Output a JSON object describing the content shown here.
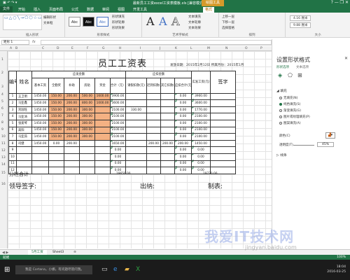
{
  "window": {
    "title": "最新员工工资excel工资表模板.xls [兼容模式] - Excel",
    "context_tab": "绘图工具",
    "window_controls": "?  —  ❐  ✕"
  },
  "ribbon_tabs": [
    "文件",
    "开始",
    "插入",
    "页面布局",
    "公式",
    "数据",
    "审阅",
    "视图",
    "开发工具",
    "格式"
  ],
  "ribbon": {
    "edit_shape": "编辑形状",
    "text_box": "文本框",
    "group_insert_shapes": "插入形状",
    "style_labels": [
      "Abc",
      "Abc",
      "Abc"
    ],
    "shape_fill": "形状填充",
    "shape_outline": "形状轮廓",
    "shape_effects": "形状效果",
    "group_shape_styles": "形状样式",
    "wordart_letters": [
      "A",
      "A",
      "A"
    ],
    "text_fill": "文本填充",
    "text_outline": "文本轮廓",
    "text_effects": "文本效果",
    "group_wordart": "艺术字样式",
    "arrange_items": [
      "上移一层",
      "下移一层",
      "选择窗格"
    ],
    "group_arrange": "排列",
    "height_value": "4.16 厘米",
    "width_value": "9.88 厘米",
    "group_size": "大小"
  },
  "formula_bar": {
    "name_box": "矩形 1",
    "fx_label": "fx",
    "formula": ""
  },
  "columns": [
    "A",
    "B",
    "C",
    "D",
    "E",
    "F",
    "G",
    "H",
    "I",
    "J",
    "K",
    "L",
    "M",
    "N",
    "O",
    "P"
  ],
  "rows": [
    "1",
    "2",
    "3",
    "4",
    "5",
    "6",
    "7",
    "8",
    "9",
    "10",
    "11",
    "12",
    "13",
    "14",
    "15",
    "16"
  ],
  "sheet": {
    "title": "员工工资表",
    "issue_info": "发放日期：2015年2月12日  所属月份：2015年1月",
    "headers": {
      "seq": "编号",
      "name": "姓名",
      "payable_group": "应发金额",
      "base_salary": "基本工资",
      "full_attendance": "全勤奖",
      "subsidy": "补助",
      "overtime": "房贴",
      "bonus": "奖金",
      "total": "合计（元）",
      "deduct_group": "应扣金额",
      "leave_deduct": "请假扣款(元)",
      "other_deduct": "迟到扣款(元)",
      "other_deduct2": "其它扣款(元)",
      "deduct_total": "应扣合计(元)",
      "net_pay": "实发工资(元)",
      "signature": "签字"
    },
    "rows": [
      {
        "no": "1",
        "name": "王卫明",
        "base": "1450.00",
        "full": "150.00",
        "sub": "200.00",
        "ot": "500.00",
        "bonus": "1600.00",
        "total": "3900.00",
        "leave": "",
        "late": "",
        "other": "",
        "dt": "0.00",
        "net": "3900.00"
      },
      {
        "no": "2",
        "name": "马亚鑫",
        "base": "1450.00",
        "full": "150.00",
        "sub": "200.00",
        "ot": "800.00",
        "bonus": "1000.00",
        "total": "3600.00",
        "leave": "",
        "late": "",
        "other": "",
        "dt": "0.00",
        "net": "3600.00"
      },
      {
        "no": "3",
        "name": "刘国旺",
        "base": "1450.00",
        "full": "150.00",
        "sub": "200.00",
        "ot": "300.00",
        "bonus": "",
        "total": "2100.00",
        "leave": "330.00",
        "late": "",
        "other": "",
        "dt": "0.00",
        "net": "1770.00"
      },
      {
        "no": "4",
        "name": "马亚涛",
        "base": "1450.00",
        "full": "150.00",
        "sub": "200.00",
        "ot": "300.00",
        "bonus": "",
        "total": "2100.00",
        "leave": "",
        "late": "",
        "other": "",
        "dt": "0.00",
        "net": "2100.00"
      },
      {
        "no": "5",
        "name": "张爱琴",
        "base": "1450.00",
        "full": "150.00",
        "sub": "200.00",
        "ot": "300.00",
        "bonus": "",
        "total": "2100.00",
        "leave": "",
        "late": "",
        "other": "",
        "dt": "0.00",
        "net": "2100.00"
      },
      {
        "no": "6",
        "name": "高阳",
        "base": "1450.00",
        "full": "150.00",
        "sub": "200.00",
        "ot": "300.00",
        "bonus": "",
        "total": "2100.00",
        "leave": "",
        "late": "",
        "other": "",
        "dt": "0.00",
        "net": "2100.00"
      },
      {
        "no": "7",
        "name": "马亚茹",
        "base": "1450.00",
        "full": "150.00",
        "sub": "200.00",
        "ot": "300.00",
        "bonus": "",
        "total": "2100.00",
        "leave": "",
        "late": "",
        "other": "",
        "dt": "0.00",
        "net": "2100.00"
      },
      {
        "no": "8",
        "name": "司健",
        "base": "1450.00",
        "full": "0.00",
        "sub": "200.00",
        "ot": "",
        "bonus": "",
        "total": "1650.00",
        "leave": "",
        "late": "200.00",
        "other": "200.00",
        "dt": "200.00",
        "net": "1450.00"
      },
      {
        "no": "9",
        "name": "",
        "base": "",
        "full": "",
        "sub": "",
        "ot": "",
        "bonus": "",
        "total": "0.00",
        "leave": "",
        "late": "",
        "other": "",
        "dt": "0.00",
        "net": "0.00"
      },
      {
        "no": "10",
        "name": "",
        "base": "",
        "full": "",
        "sub": "",
        "ot": "",
        "bonus": "",
        "total": "0.00",
        "leave": "",
        "late": "",
        "other": "",
        "dt": "0.00",
        "net": "0.00"
      },
      {
        "no": "11",
        "name": "",
        "base": "",
        "full": "",
        "sub": "",
        "ot": "",
        "bonus": "",
        "total": "0.00",
        "leave": "",
        "late": "",
        "other": "",
        "dt": "0.00",
        "net": "0.00"
      },
      {
        "no": "12",
        "name": "",
        "base": "",
        "full": "",
        "sub": "",
        "ot": "",
        "bonus": "",
        "total": "0.00",
        "leave": "",
        "late": "",
        "other": "",
        "dt": "0.00",
        "net": "0.00"
      }
    ],
    "subtotal_label": "分栏合计",
    "subtotal_total": "19650.00",
    "subtotal_net": "19770.00",
    "sig_leader": "领导签字:",
    "sig_cashier": "出纳:",
    "sig_preparer": "制表:",
    "highlight_color": "#f4b183"
  },
  "pane": {
    "title": "设置形状格式",
    "close": "✕",
    "tab_shape": "形状选项",
    "tab_text": "文本选项",
    "section_fill": "◢ 填充",
    "fill_options": [
      "无填充(N)",
      "纯色填充(S)",
      "渐变填充(G)",
      "图片或纹理填充(P)",
      "图案填充(A)"
    ],
    "selected_fill_index": 1,
    "color_label": "颜色(C)",
    "transparency_label": "透明度(T)",
    "transparency_value": "45%",
    "section_line": "▷ 线条"
  },
  "sheet_tabs": [
    "5月工资",
    "Sheet3"
  ],
  "add_sheet": "⊕",
  "status": {
    "left": "就绪",
    "zoom": "100%"
  },
  "taskbar": {
    "search_placeholder": "我是 Cortana，小娜。有问题尽管问我。",
    "clock_time": "18:04",
    "clock_date": "2016-03-25"
  },
  "watermark": "我爱IT技术网",
  "watermark_url": "jingyan.baidu.com",
  "colors": {
    "accent": "#217346",
    "context_tab": "#d69a2a"
  }
}
